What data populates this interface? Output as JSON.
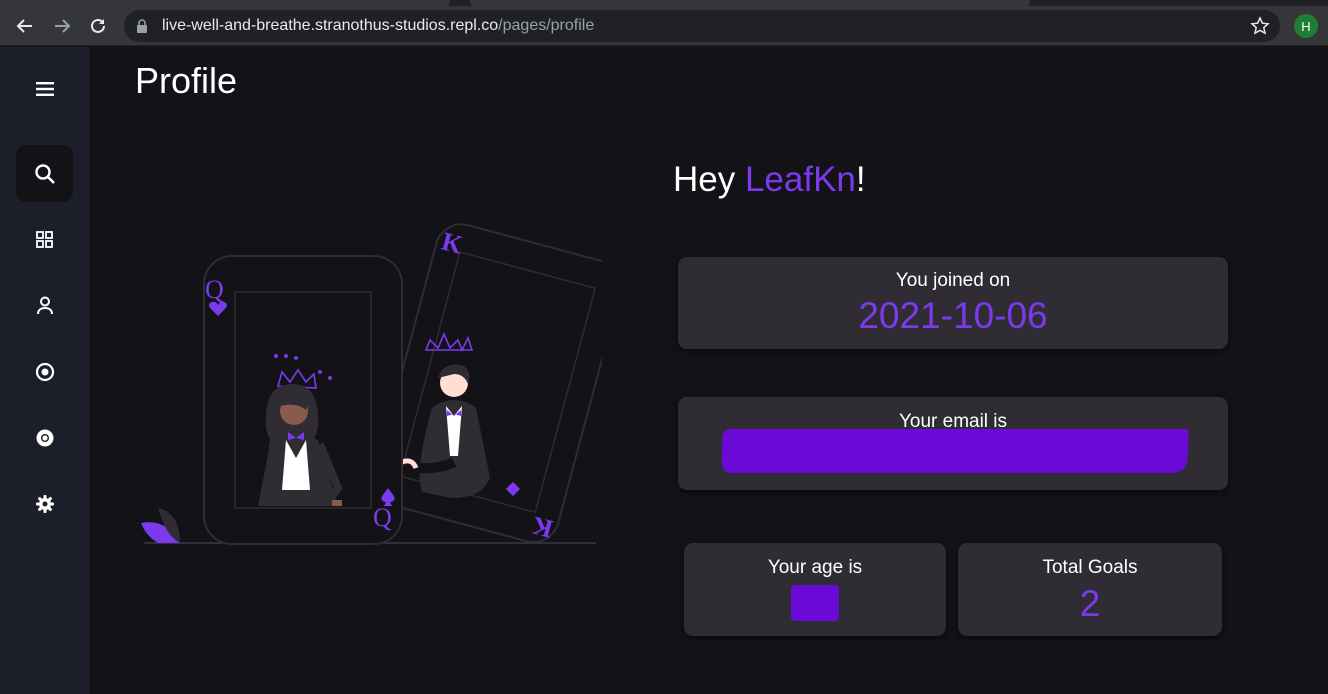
{
  "browser": {
    "url_host": "live-well-and-breathe.stranothus-studios.repl.co",
    "url_path": "/pages/profile",
    "profile_initial": "H"
  },
  "sidebar": {
    "items": [
      {
        "icon": "menu-icon"
      },
      {
        "icon": "search-icon",
        "active": true
      },
      {
        "icon": "grid-icon"
      },
      {
        "icon": "user-icon"
      },
      {
        "icon": "target-icon"
      },
      {
        "icon": "chrome-icon"
      },
      {
        "icon": "gear-icon"
      }
    ]
  },
  "page": {
    "title": "Profile",
    "greeting_prefix": "Hey ",
    "username": "LeafKn",
    "greeting_suffix": "!"
  },
  "cards": {
    "joined_label": "You joined on",
    "joined_value": "2021-10-06",
    "email_label": "Your email is",
    "age_label": "Your age is",
    "goals_label": "Total Goals",
    "goals_value": "2"
  },
  "colors": {
    "accent": "#7c3aed",
    "redaction": "#6a0ad6",
    "card_bg": "#2f2c33",
    "page_bg": "#121217",
    "sidebar_bg": "#1c1f29"
  }
}
